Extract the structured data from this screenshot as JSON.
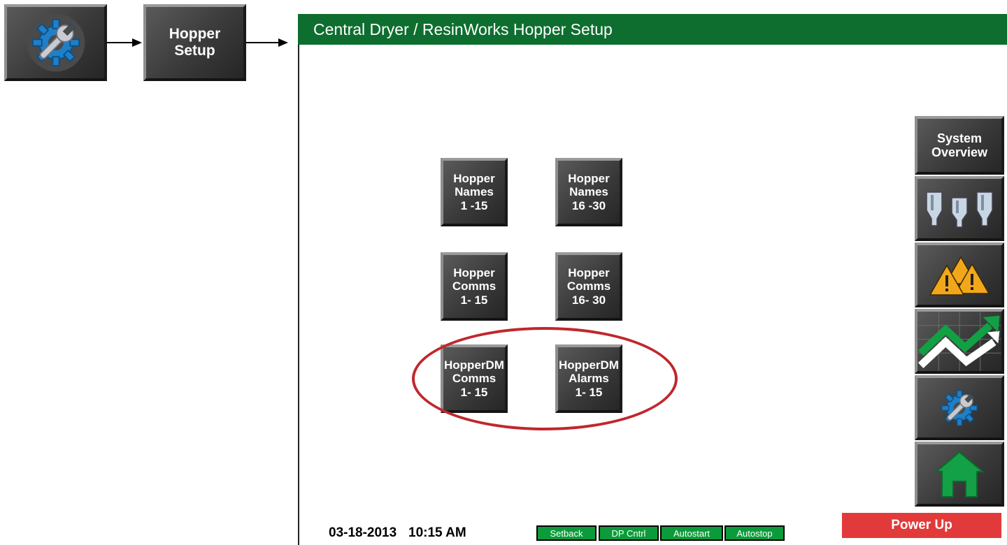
{
  "nav_steps": {
    "setup_icon": "wrench-gear-icon",
    "hopper_setup_label": [
      "Hopper",
      "Setup"
    ]
  },
  "screen": {
    "title": "Central Dryer / ResinWorks Hopper Setup",
    "title_bar_color": "#0e6e2f"
  },
  "grid_buttons": [
    {
      "lines": [
        "Hopper",
        "Names",
        "1 -15"
      ]
    },
    {
      "lines": [
        "Hopper",
        "Names",
        "16 -30"
      ]
    },
    {
      "lines": [
        "Hopper",
        "Comms",
        "1- 15"
      ]
    },
    {
      "lines": [
        "Hopper",
        "Comms",
        "16- 30"
      ]
    },
    {
      "lines": [
        "HopperDM",
        "Comms",
        "1- 15"
      ]
    },
    {
      "lines": [
        "HopperDM",
        "Alarms",
        "1- 15"
      ]
    }
  ],
  "side_nav": {
    "system_overview": [
      "System",
      "Overview"
    ],
    "icons": [
      "hoppers-icon",
      "alarms-icon",
      "trend-icon",
      "setup-icon",
      "home-icon"
    ]
  },
  "footer": {
    "date": "03-18-2013",
    "time": "10:15 AM",
    "status": [
      "Setback",
      "DP Cntrl",
      "Autostart",
      "Autostop"
    ],
    "power_button": "Power Up",
    "status_color": "#0c9b3a",
    "power_color": "#e23a3a"
  },
  "highlight_color": "#c0272d"
}
